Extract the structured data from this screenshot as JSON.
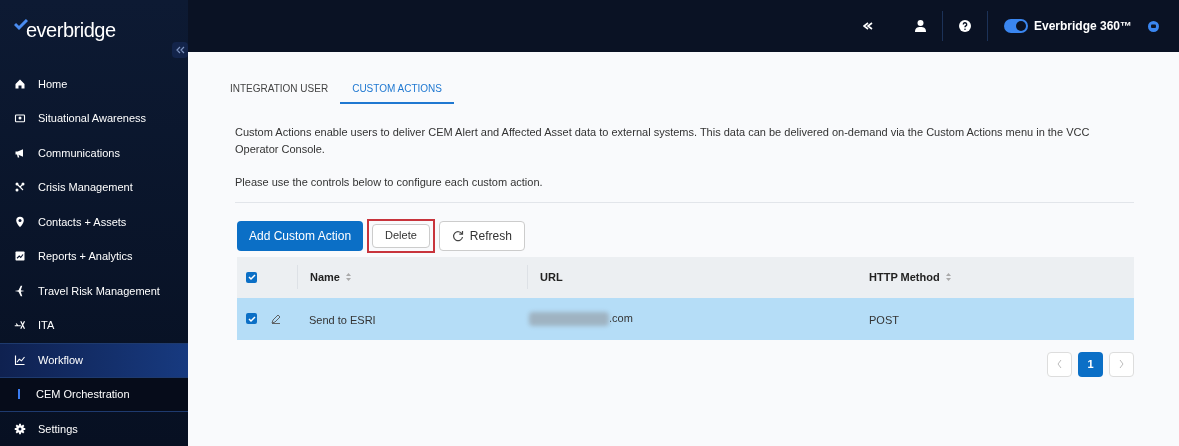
{
  "sidebar": {
    "logo": "everbridge",
    "items": [
      {
        "label": "Home",
        "selected": false
      },
      {
        "label": "Situational Awareness",
        "selected": false
      },
      {
        "label": "Communications",
        "selected": false
      },
      {
        "label": "Crisis Management",
        "selected": false
      },
      {
        "label": "Contacts + Assets",
        "selected": false
      },
      {
        "label": "Reports + Analytics",
        "selected": false
      },
      {
        "label": "Travel Risk Management",
        "selected": false
      },
      {
        "label": "ITA",
        "selected": false
      },
      {
        "label": "Workflow",
        "selected": true,
        "children": [
          {
            "label": "CEM Orchestration",
            "selected": true
          }
        ]
      },
      {
        "label": "Settings",
        "selected": false
      }
    ]
  },
  "header": {
    "product": "Everbridge 360™",
    "toggle_on": true
  },
  "tabs": [
    {
      "label": "INTEGRATION USER",
      "selected": false
    },
    {
      "label": "CUSTOM ACTIONS",
      "selected": true
    }
  ],
  "description": "Custom Actions enable users to deliver CEM Alert and Affected Asset data to external systems. This data can be delivered on-demand via the Custom Actions menu in the VCC Operator Console.",
  "instruction": "Please use the controls below to configure each custom action.",
  "buttons": [
    {
      "label": "Add Custom Action",
      "kind": "primary",
      "highlighted": false
    },
    {
      "label": "Delete",
      "kind": "plain",
      "highlighted": true
    },
    {
      "label": "Refresh",
      "kind": "refresh",
      "highlighted": false
    }
  ],
  "table": {
    "all_checked": true,
    "columns": [
      {
        "label": "Name",
        "sortable": true
      },
      {
        "label": "URL",
        "sortable": false
      },
      {
        "label": "HTTP Method",
        "sortable": true
      }
    ],
    "rows": [
      {
        "checked": true,
        "selected": true,
        "name": "Send to ESRI",
        "url": ".com",
        "url_redacted": true,
        "method": "POST"
      }
    ]
  },
  "pagination": {
    "pages": [
      {
        "label": "1",
        "selected": true
      }
    ]
  }
}
